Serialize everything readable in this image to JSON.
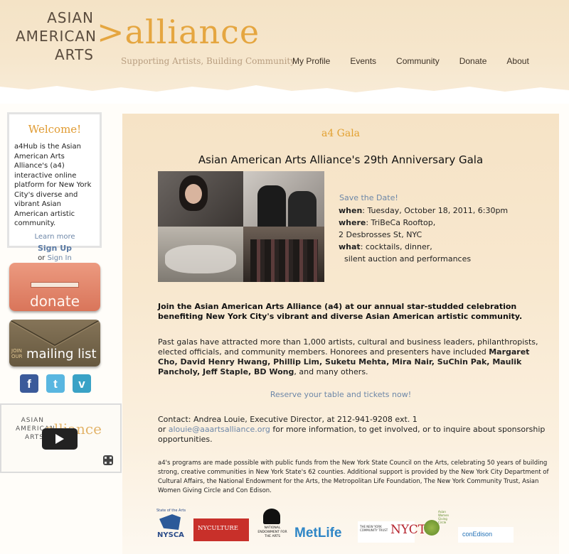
{
  "header": {
    "logo_asian": "ASIAN",
    "logo_american": "AMERICAN",
    "logo_arts": "ARTS",
    "logo_alliance": ">alliance",
    "tagline": "Supporting Artists, Building Community",
    "nav": [
      "My Profile",
      "Events",
      "Community",
      "Donate",
      "About"
    ]
  },
  "sidebar": {
    "welcome_title": "Welcome!",
    "welcome_text": "a4Hub is the Asian American Arts Alliance's (a4) interactive online platform for New York City's diverse and vibrant Asian American artistic community.",
    "learn_more": "Learn more",
    "sign_up": "Sign Up",
    "or": "or",
    "sign_in": "Sign In",
    "donate_label": "donate",
    "mailing_join": "JOIN\nOUR",
    "mailing_label": "mailing list",
    "social": {
      "facebook": "f",
      "twitter": "t",
      "vimeo": "v"
    },
    "video": {
      "asian": "ASIAN",
      "american": "AMERICAN",
      "arts": "ARTS",
      "alliance": "alliance"
    }
  },
  "main": {
    "heading": "a4 Gala",
    "title": "Asian American Arts Alliance's 29th Anniversary Gala",
    "save_date": "Save the Date!",
    "when_label": "when",
    "when_value": ": Tuesday, October 18, 2011, 6:30pm",
    "where_label": "where",
    "where_value": ": TriBeCa Rooftop,",
    "address": "2 Desbrosses St, NYC",
    "what_label": "what",
    "what_value": ": cocktails, dinner,",
    "what_value2": "silent auction and performances",
    "intro": "Join the Asian American Arts Alliance (a4) at our annual star-studded celebration benefiting New York City's vibrant and diverse Asian American artistic community.",
    "past_1": "Past galas have attracted more than 1,000 artists, cultural and business leaders, philanthropists, elected officials, and community members. Honorees and presenters have included ",
    "past_names": "Margaret Cho, David Henry Hwang, Phillip Lim, Suketu Mehta, Mira Nair, SuChin Pak, Maulik Pancholy, Jeff Staple, BD Wong",
    "past_2": ", and many others.",
    "reserve": "Reserve your table and tickets now!",
    "contact_1": "Contact: Andrea Louie, Executive Director, at 212-941-9208 ext. 1",
    "contact_or": "or ",
    "contact_email": "alouie@aaartsalliance.org",
    "contact_2": " for more information, to get involved, or to inquire about sponsorship opportunities.",
    "funding": "a4's programs are made possible with public funds from the New York State Council on the Arts, celebrating 50 years of building strong, creative communities in New York State's 62 counties. Additional support is provided by the New York City Department of Cultural Affairs, the National Endowment for the Arts, the Metropolitan Life Foundation, The New York Community Trust, Asian Women Giving Circle and Con Edison.",
    "sponsors": {
      "nysca_top": "State of the Arts",
      "nysca": "NYSCA",
      "nyculture": "NYCULTURE",
      "nea": "NATIONAL ENDOWMENT FOR THE ARTS",
      "metlife": "MetLife",
      "nyct_small": "THE NEW YORK COMMUNITY TRUST",
      "nyct": "NYCT",
      "awgc": "Asian Women Giving Circle",
      "conedison": "conEdison"
    }
  },
  "colors": {
    "accent": "#e2a131",
    "link": "#6d87a8",
    "donate": "#dd7b5f",
    "mailing": "#75664b"
  }
}
